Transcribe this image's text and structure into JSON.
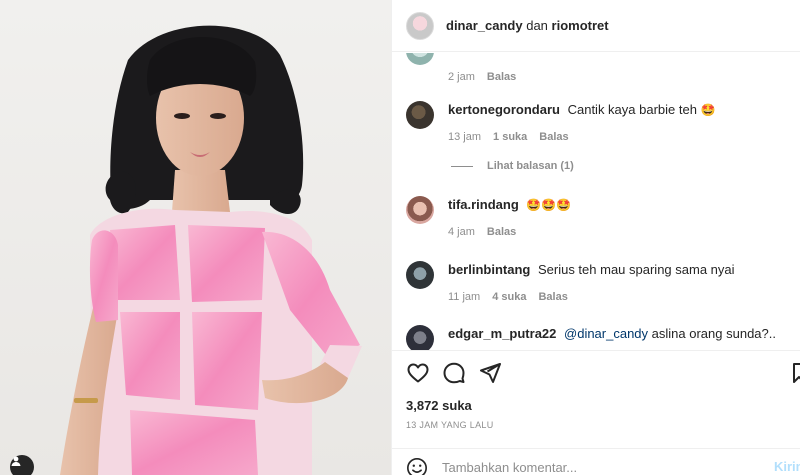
{
  "header": {
    "owner": "dinar_candy",
    "conjunction": "dan",
    "collaborator": "riomotret"
  },
  "comments": [
    {
      "user": "",
      "text": "",
      "time": "2 jam",
      "likes": "",
      "reply": "Balas"
    },
    {
      "user": "kertonegorondaru",
      "text": "Cantik kaya barbie teh",
      "emoji": "🤩",
      "time": "13 jam",
      "likes": "1 suka",
      "reply": "Balas"
    },
    {
      "user": "tifa.rindang",
      "text": "",
      "emoji": "🤩🤩🤩",
      "time": "4 jam",
      "likes": "",
      "reply": "Balas"
    },
    {
      "user": "berlinbintang",
      "text": "Serius teh mau sparing sama nyai",
      "time": "11 jam",
      "likes": "4 suka",
      "reply": "Balas"
    },
    {
      "user": "edgar_m_putra22",
      "mention": "@dinar_candy",
      "text": "aslina orang sunda?..",
      "time": "",
      "likes": "",
      "reply": ""
    }
  ],
  "view_replies": "Lihat balasan (1)",
  "actions": {
    "like_icon": "heart-icon",
    "comment_icon": "comment-icon",
    "share_icon": "paper-plane-icon",
    "save_icon": "bookmark-icon"
  },
  "likes_count": "3,872 suka",
  "time_ago": "13 JAM YANG LALU",
  "add_comment": {
    "placeholder": "Tambahkan komentar...",
    "post_label": "Kirim"
  },
  "colors": {
    "text": "#262626",
    "secondary": "#8e8e8e",
    "link": "#00376b",
    "post_disabled": "#b2dffc",
    "border": "#efefef"
  }
}
